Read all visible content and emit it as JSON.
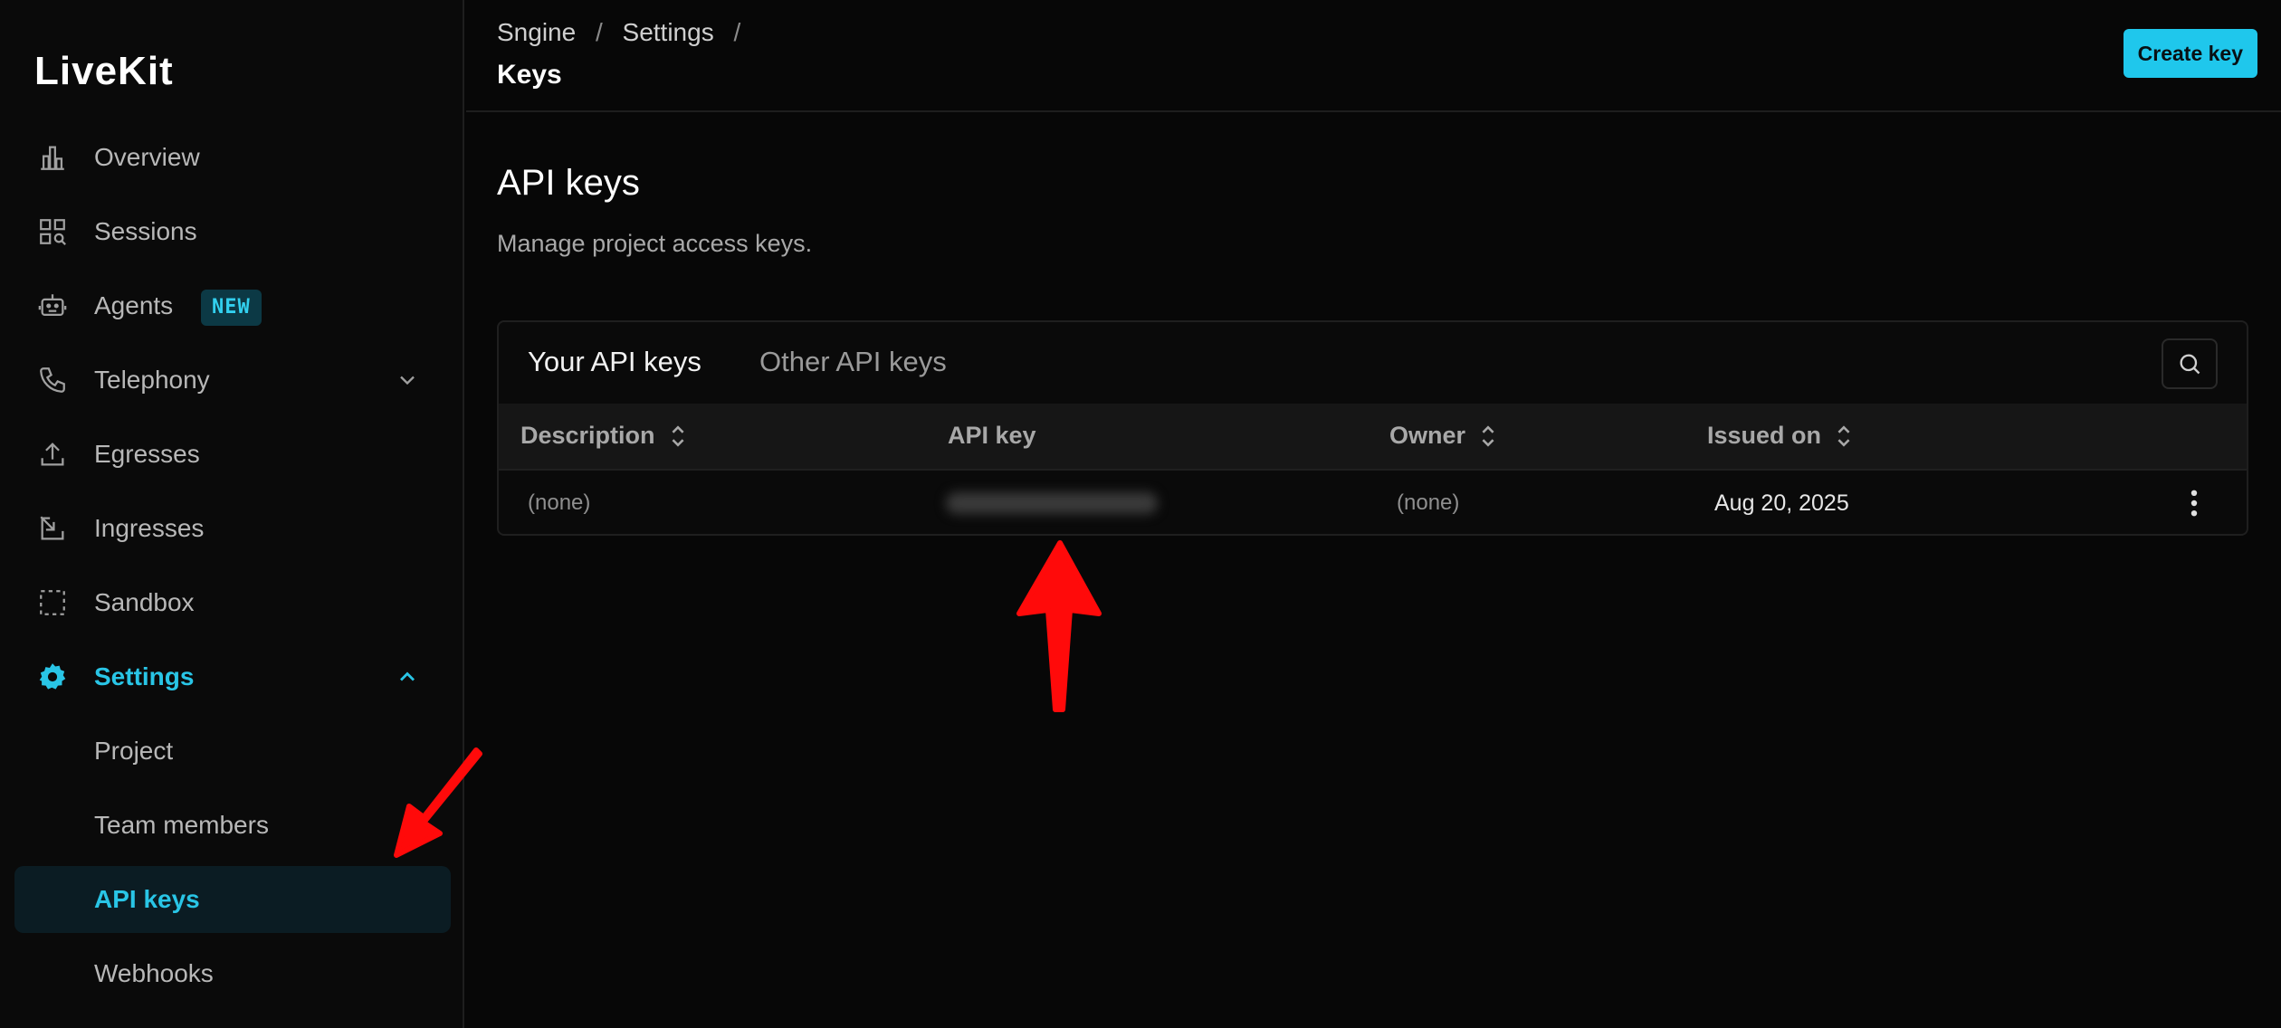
{
  "app": {
    "logo": "LiveKit"
  },
  "header": {
    "breadcrumbs": [
      "Sngine",
      "Settings"
    ],
    "separator": "/",
    "title": "Keys",
    "create_label": "Create key"
  },
  "sidebar": {
    "items": [
      {
        "label": "Overview",
        "icon": "bar-chart-icon"
      },
      {
        "label": "Sessions",
        "icon": "sessions-grid-icon"
      },
      {
        "label": "Agents",
        "icon": "robot-icon",
        "badge": "NEW"
      },
      {
        "label": "Telephony",
        "icon": "phone-icon"
      },
      {
        "label": "Egresses",
        "icon": "upload-icon"
      },
      {
        "label": "Ingresses",
        "icon": "ingress-icon"
      },
      {
        "label": "Sandbox",
        "icon": "dashed-square-icon"
      },
      {
        "label": "Settings",
        "icon": "gear-icon"
      }
    ],
    "settings_sub": [
      {
        "label": "Project"
      },
      {
        "label": "Team members"
      },
      {
        "label": "API keys"
      },
      {
        "label": "Webhooks"
      }
    ],
    "accent": "#29c5e6"
  },
  "main": {
    "title": "API keys",
    "subtitle": "Manage project access keys.",
    "tabs": [
      "Your API keys",
      "Other API keys"
    ],
    "columns": [
      "Description",
      "API key",
      "Owner",
      "Issued on"
    ],
    "rows": [
      {
        "description": "(none)",
        "owner": "(none)",
        "issued_on": "Aug 20, 2025"
      }
    ]
  }
}
